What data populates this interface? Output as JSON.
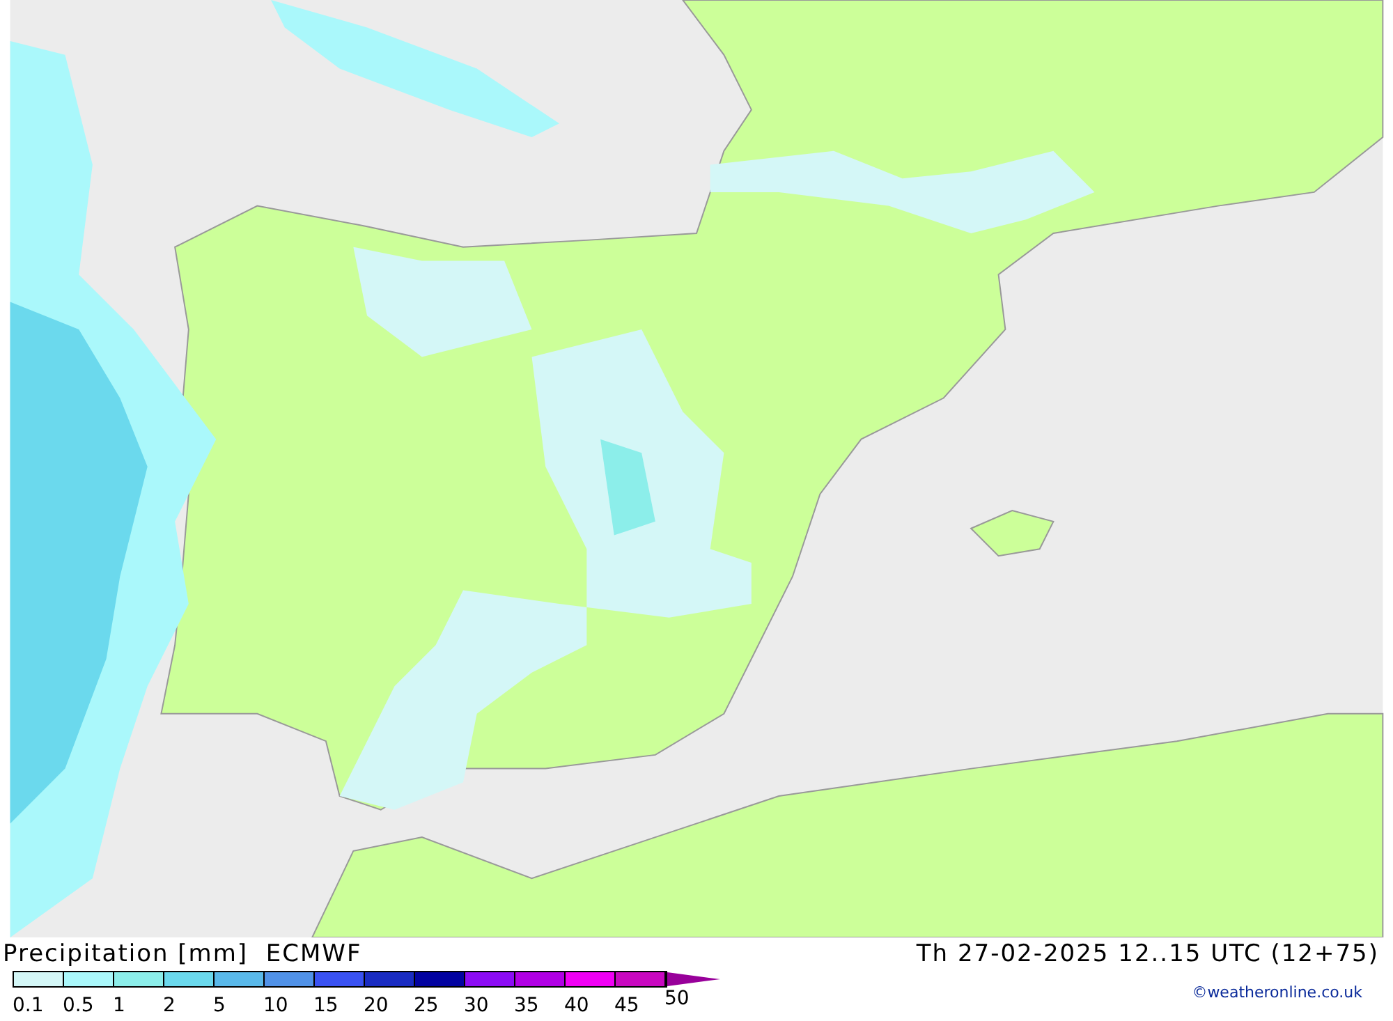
{
  "title": "Precipitation [mm]  ECMWF",
  "valid_time": "Th 27-02-2025 12..15 UTC (12+75)",
  "legend": {
    "bins": [
      {
        "label": "0.1",
        "color": "#d4f7f7"
      },
      {
        "label": "0.5",
        "color": "#aaf8fb"
      },
      {
        "label": "1",
        "color": "#8ceeea"
      },
      {
        "label": "2",
        "color": "#6bd9ed"
      },
      {
        "label": "5",
        "color": "#5ab9ea"
      },
      {
        "label": "10",
        "color": "#5192e8"
      },
      {
        "label": "15",
        "color": "#3a52f2"
      },
      {
        "label": "20",
        "color": "#1a2cc2"
      },
      {
        "label": "25",
        "color": "#0303a0"
      },
      {
        "label": "30",
        "color": "#8c0cf4"
      },
      {
        "label": "35",
        "color": "#b000e4"
      },
      {
        "label": "40",
        "color": "#f000f4"
      },
      {
        "label": "45",
        "color": "#c808c0"
      }
    ],
    "end_label": "50",
    "arrow": {
      "color": "#98009a"
    }
  },
  "credit": "©weatheronline.co.uk"
}
